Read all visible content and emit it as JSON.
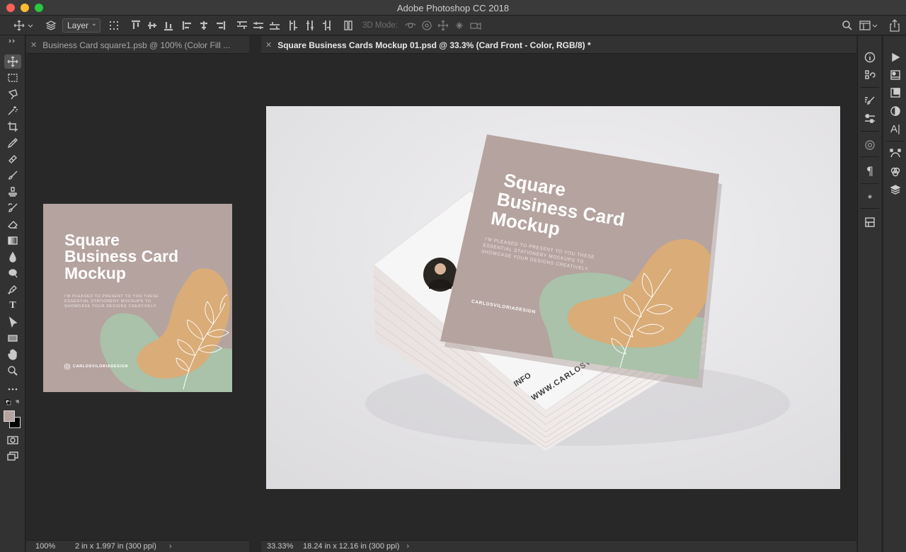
{
  "window": {
    "title": "Adobe Photoshop CC 2018",
    "traffic_lights": [
      "#fe5f57",
      "#febc2e",
      "#28c840"
    ]
  },
  "options_bar": {
    "layer_select": "Layer",
    "mode_3d_label": "3D Mode:"
  },
  "documents": [
    {
      "tab_title": "Business Card square1.psb @ 100% (Color Fill ...",
      "zoom": "100%",
      "doc_info": "2 in x 1.997 in (300 ppi)"
    },
    {
      "tab_title": "Square Business Cards Mockup 01.psd @ 33.3% (Card Front - Color, RGB/8) *",
      "zoom": "33.33%",
      "doc_info": "18.24 in x 12.16 in (300 ppi)"
    }
  ],
  "card": {
    "title_line1": "Square",
    "title_line2": "Business Card",
    "title_line3": "Mockup",
    "body_line1": "I'M PLEASED TO PRESENT TO YOU THESE",
    "body_line2": "ESSENTIAL STATIONERY MOCKUPS TO",
    "body_line3": "SHOWCASE YOUR DESIGNS CREATIVELY.",
    "social_handle": "CARLOSVILORIADESIGN",
    "back_partial_text_1": "INFO",
    "back_partial_text_2": "WWW.CARLOSVILO",
    "colors": {
      "card_bg": "#b5a39f",
      "blob_orange": "#d9ac78",
      "blob_green": "#a9c2a9"
    }
  },
  "status_arrow": "›",
  "colors": {
    "foreground_swatch": "#b5a39f",
    "background_swatch": "#000000"
  }
}
